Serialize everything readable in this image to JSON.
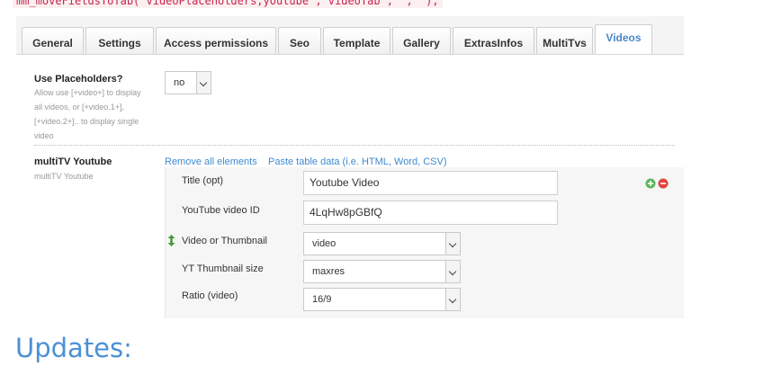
{
  "code_snippet": "mm_moveFieldsToTab('videoPlaceholders,youtube','videoTab','','');",
  "tabs": [
    "General",
    "Settings",
    "Access permissions",
    "Seo",
    "Template",
    "Gallery",
    "ExtrasInfos",
    "MultiTvs",
    "Videos"
  ],
  "active_tab": "Videos",
  "placeholders": {
    "title": "Use Placeholders?",
    "desc_lines": [
      "Allow use [+video+] to display",
      "all videos, or [+video.1+],",
      "[+video.2+].. to display single",
      "video"
    ],
    "value": "no"
  },
  "multitv": {
    "title": "multiTV Youtube",
    "subtitle": "multiTV Youtube",
    "remove_all": "Remove all elements",
    "paste": "Paste table data (i.e. HTML, Word, CSV)",
    "fields": {
      "title_label": "Title (opt)",
      "title_value": "Youtube Video",
      "id_label": "YouTube video ID",
      "id_value": "4LqHw8pGBfQ",
      "thumb_label": "Video or Thumbnail",
      "thumb_value": "video",
      "size_label": "YT Thumbnail size",
      "size_value": "maxres",
      "ratio_label": "Ratio (video)",
      "ratio_value": "16/9"
    }
  },
  "icons": {
    "add": "add-icon",
    "remove": "remove-icon",
    "sort": "sort-arrows-icon",
    "add_color": "#5cb85c",
    "remove_color": "#e0463c"
  },
  "heading": "Updates:"
}
